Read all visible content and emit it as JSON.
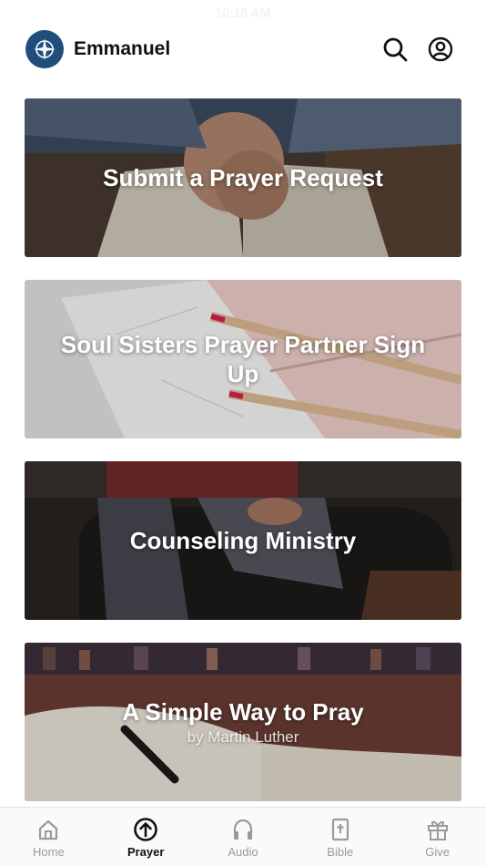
{
  "status_bar": {
    "time": "10:15 AM"
  },
  "header": {
    "app_name": "Emmanuel"
  },
  "cards": [
    {
      "title": "Submit a Prayer Request",
      "subtitle": ""
    },
    {
      "title": "Soul Sisters Prayer Partner Sign Up",
      "subtitle": ""
    },
    {
      "title": "Counseling Ministry",
      "subtitle": ""
    },
    {
      "title": "A Simple Way to Pray",
      "subtitle": "by Martin Luther"
    }
  ],
  "tabbar": {
    "tabs": [
      {
        "label": "Home",
        "icon": "home-icon",
        "active": false
      },
      {
        "label": "Prayer",
        "icon": "prayer-arrow-icon",
        "active": true
      },
      {
        "label": "Audio",
        "icon": "headphones-icon",
        "active": false
      },
      {
        "label": "Bible",
        "icon": "bible-icon",
        "active": false
      },
      {
        "label": "Give",
        "icon": "gift-icon",
        "active": false
      }
    ]
  },
  "colors": {
    "brand": "#1f4e7d",
    "active_tab": "#111111",
    "inactive_tab": "#9a9a9a"
  }
}
